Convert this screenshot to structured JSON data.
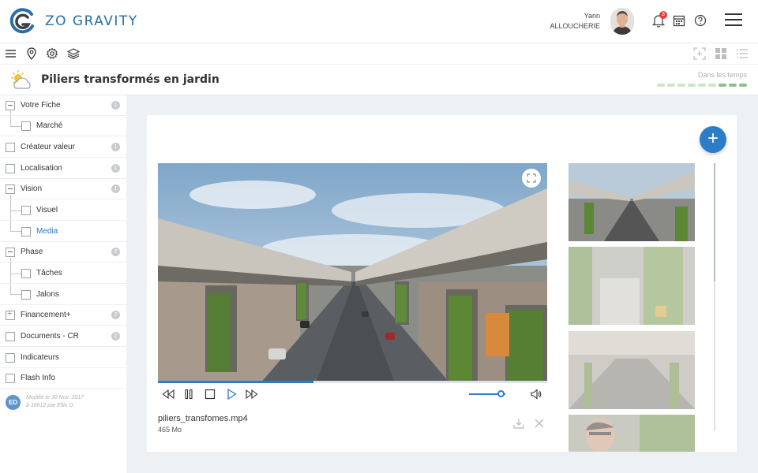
{
  "app": {
    "brand": "ZO GRAVITY"
  },
  "user": {
    "first_name": "Yann",
    "last_name": "ALLOUCHERIE"
  },
  "notifications": {
    "count": "3"
  },
  "page": {
    "title": "Piliers transformés en jardin",
    "timing_label": "Dans les temps"
  },
  "timing": {
    "segments_total": 9,
    "segments_done": 3
  },
  "sidebar": {
    "items": [
      {
        "label": "Votre Fiche",
        "badge": "1"
      },
      {
        "label": "Marché",
        "badge": ""
      },
      {
        "label": "Créateur valeur",
        "badge": "1"
      },
      {
        "label": "Localisation",
        "badge": "1"
      },
      {
        "label": "Vision",
        "badge": "1"
      },
      {
        "label": "Visuel",
        "badge": ""
      },
      {
        "label": "Media",
        "badge": ""
      },
      {
        "label": "Phase",
        "badge": "2"
      },
      {
        "label": "Tâches",
        "badge": ""
      },
      {
        "label": "Jalons",
        "badge": ""
      },
      {
        "label": "Financement+",
        "badge": "2"
      },
      {
        "label": "Documents - CR",
        "badge": "2"
      },
      {
        "label": "Indicateurs",
        "badge": ""
      },
      {
        "label": "Flash Info",
        "badge": ""
      }
    ],
    "modified": {
      "initials": "ED",
      "line1": "Modifié le 30 Nov. 2017",
      "line2": "à 16h12 par Ellio D."
    }
  },
  "media": {
    "file_name": "piliers_transfomes.mp4",
    "file_size": "465 Mo",
    "playback_progress": 0.4,
    "volume": 0.9
  },
  "icons": {
    "header": [
      "bell-icon",
      "calendar-icon",
      "help-icon",
      "menu-icon"
    ],
    "toolbar": [
      "menu-icon",
      "location-pin-icon",
      "settings-icon",
      "layers-icon",
      "focus-icon",
      "grid-icon",
      "list-icon"
    ],
    "player": [
      "rewind-icon",
      "pause-icon",
      "stop-icon",
      "play-icon",
      "fast-forward-icon",
      "volume-icon"
    ]
  },
  "colors": {
    "accent": "#2d7cc7",
    "brand": "#2a6fa5",
    "badge_red": "#e2413c",
    "timing_green": "#8cc08a"
  }
}
